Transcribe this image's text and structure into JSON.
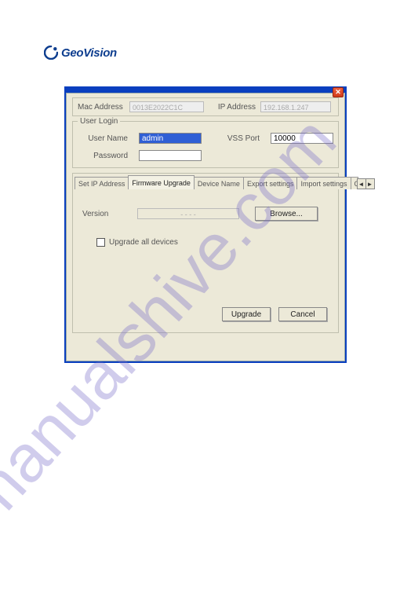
{
  "brand": "GeoVision",
  "watermark": "manualshive.com",
  "close_symbol": "✕",
  "top": {
    "mac_label": "Mac Address",
    "mac_value": "0013E2022C1C",
    "ip_label": "IP Address",
    "ip_value": "192.168.1.247"
  },
  "login": {
    "legend": "User Login",
    "user_label": "User Name",
    "user_value": "admin",
    "pass_label": "Password",
    "pass_value": "",
    "port_label": "VSS Port",
    "port_value": "10000"
  },
  "tabs": {
    "items": [
      "Set IP Address",
      "Firmware Upgrade",
      "Device Name",
      "Export settings",
      "Import settings",
      "Camera a"
    ],
    "arrow_left": "◄",
    "arrow_right": "►"
  },
  "panel": {
    "version_label": "Version",
    "version_value": "- - - -",
    "browse_label": "Browse...",
    "upgrade_all_label": "Upgrade all devices"
  },
  "buttons": {
    "upgrade": "Upgrade",
    "cancel": "Cancel"
  }
}
